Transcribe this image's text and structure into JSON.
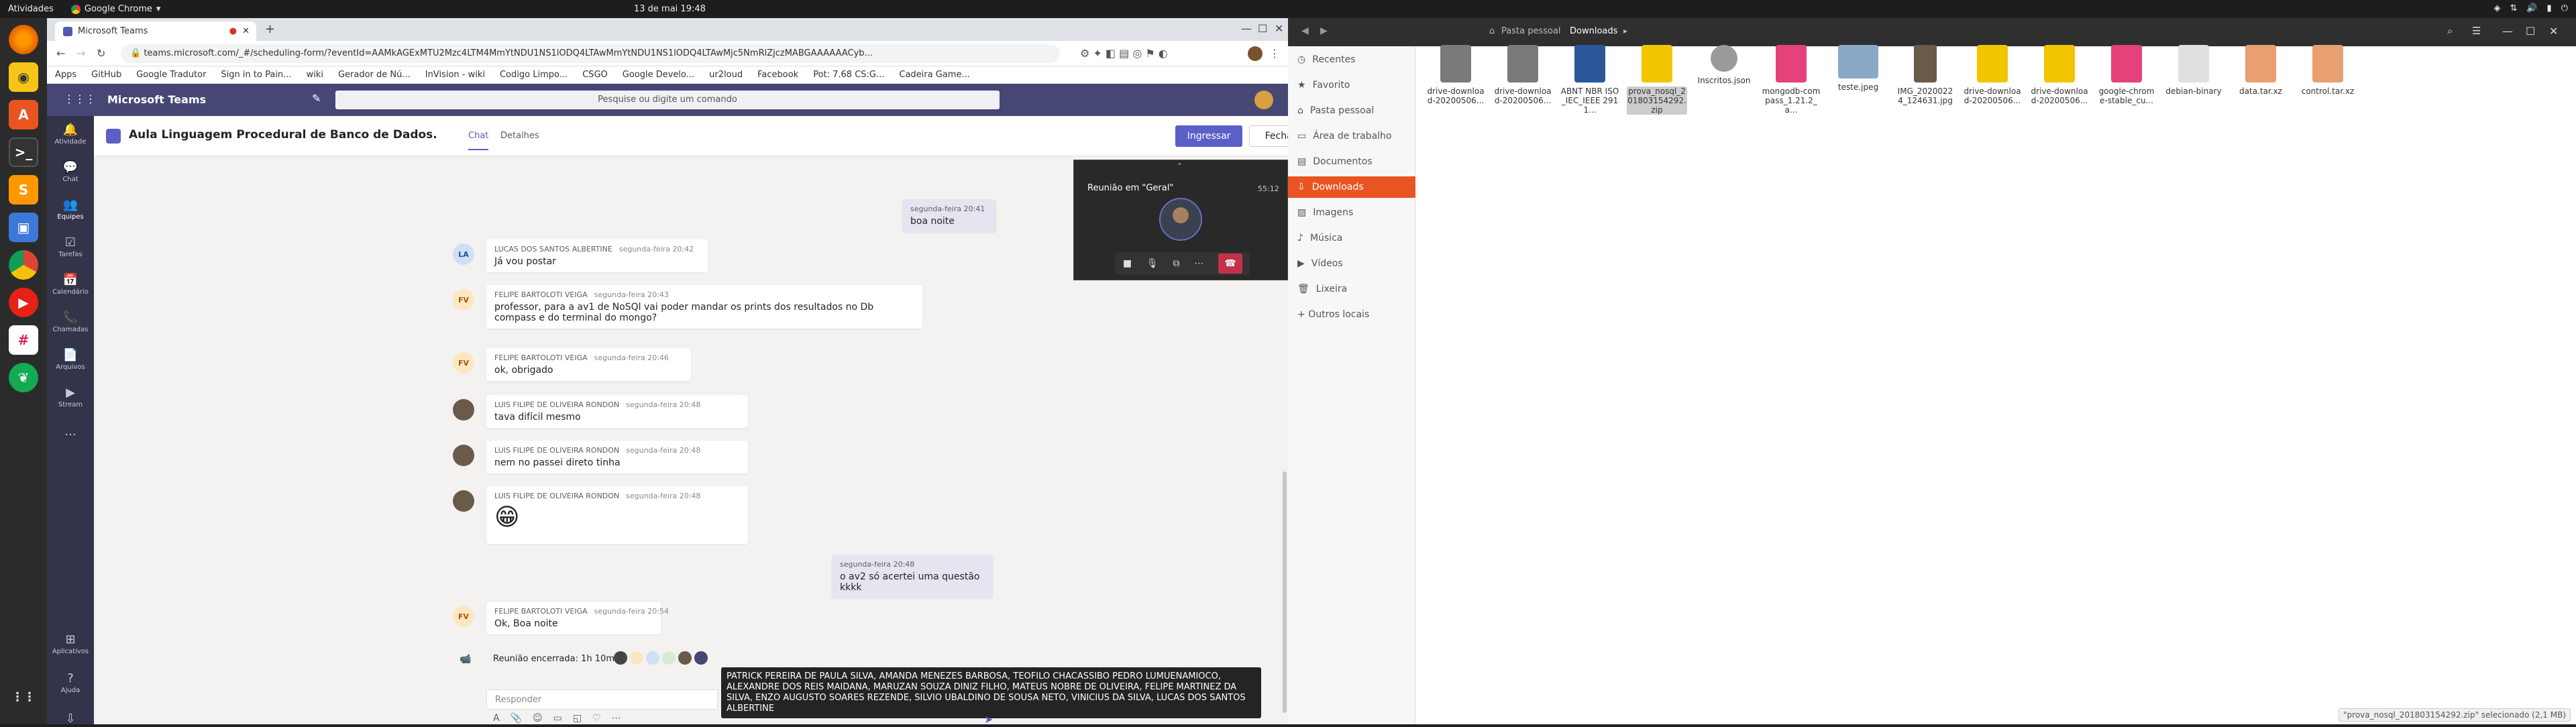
{
  "system_topbar": {
    "activities": "Atividades",
    "app_name": "Google Chrome",
    "clock": "13 de mai  19:48"
  },
  "chrome": {
    "tab_title": "Microsoft Teams",
    "url": "teams.microsoft.com/_#/scheduling-form/?eventId=AAMkAGExMTU2Mzc4LTM4MmYtNDU1NS1lODQ4LTAwMmYtNDU1NS1lODQ4LTAwMjc5NmRlZjczMABGAAAAAACyb...",
    "bookmarks": [
      "Apps",
      "GitHub",
      "Google Tradutor",
      "Sign in to Pain...",
      "wiki",
      "Gerador de Nú...",
      "InVision - wiki",
      "Codigo Limpo...",
      "CSGO",
      "Google Develo...",
      "ur2loud",
      "Facebook",
      "Pot: 7.68 CS:G...",
      "Cadeira Game..."
    ]
  },
  "teams": {
    "app_title": "Microsoft Teams",
    "search_placeholder": "Pesquise ou digite um comando",
    "rail": [
      {
        "label": "Atividade",
        "icon": "bell-icon"
      },
      {
        "label": "Chat",
        "icon": "chat-icon"
      },
      {
        "label": "Equipes",
        "icon": "teams-icon"
      },
      {
        "label": "Tarefas",
        "icon": "tasks-icon"
      },
      {
        "label": "Calendário",
        "icon": "calendar-icon"
      },
      {
        "label": "Chamadas",
        "icon": "phone-icon"
      },
      {
        "label": "Arquivos",
        "icon": "files-icon"
      },
      {
        "label": "Stream",
        "icon": "stream-icon"
      },
      {
        "label": "...",
        "icon": "more-icon"
      },
      {
        "label": "Aplicativos",
        "icon": "apps-icon"
      },
      {
        "label": "Ajuda",
        "icon": "help-icon"
      }
    ],
    "channel": {
      "name": "Aula Linguagem Procedural de Banco de Dados.",
      "tab_chat": "Chat",
      "tab_details": "Detalhes",
      "join_button": "Ingressar",
      "close_button": "Fechar"
    },
    "messages": [
      {
        "author": "",
        "time": "segunda-feira 20:41",
        "text": "boa noite",
        "mine": true
      },
      {
        "author": "LUCAS DOS SANTOS ALBERTINE",
        "time": "segunda-feira 20:42",
        "text": "Já vou postar",
        "initials": "LA"
      },
      {
        "author": "FELIPE BARTOLOTI VEIGA",
        "time": "segunda-feira 20:43",
        "text": "professor, para a av1 de NoSQl vai poder mandar os prints dos resultados no Db compass e  do terminal do mongo?",
        "initials": "FV"
      },
      {
        "author": "FELIPE BARTOLOTI VEIGA",
        "time": "segunda-feira 20:46",
        "text": "ok, obrigado",
        "initials": "FV"
      },
      {
        "author": "LUIS FILIPE DE OLIVEIRA RONDON",
        "time": "segunda-feira 20:48",
        "text": "tava difícil mesmo"
      },
      {
        "author": "LUIS FILIPE DE OLIVEIRA RONDON",
        "time": "segunda-feira 20:48",
        "text": "nem no passei direto tinha"
      },
      {
        "author": "LUIS FILIPE DE OLIVEIRA RONDON",
        "time": "segunda-feira 20:48",
        "text": "😁"
      },
      {
        "author": "",
        "time": "segunda-feira 20:48",
        "text": "o av2 só acertei uma questão kkkk",
        "mine": true
      },
      {
        "author": "FELIPE BARTOLOTI VEIGA",
        "time": "segunda-feira 20:54",
        "text": "Ok, Boa noite",
        "initials": "FV"
      }
    ],
    "meeting_ended": "Reunião encerrada: 1h 10m",
    "participants_tooltip": "PATRICK PEREIRA DE PAULA SILVA, AMANDA MENEZES BARBOSA, TEOFILO CHACASSIBO PEDRO LUMUENAMIOCO, ALEXANDRE DOS REIS MAIDANA, MARUZAN SOUZA DINIZ FILHO, MATEUS NOBRE DE OLIVEIRA, FELIPE MARTINEZ DA SILVA, ENZO AUGUSTO SOARES REZENDE, SILVIO UBALDINO DE SOUSA NETO, VINICIUS DA SILVA, LUCAS DOS SANTOS ALBERTINE",
    "reply_placeholder": "Responder",
    "call": {
      "title": "Reunião em \"Geral\"",
      "duration": "55:12"
    }
  },
  "files": {
    "location_home": "Pasta pessoal",
    "location_current": "Downloads",
    "sidebar": [
      {
        "label": "Recentes",
        "icon": "clock-icon"
      },
      {
        "label": "Favorito",
        "icon": "star-icon"
      },
      {
        "label": "Pasta pessoal",
        "icon": "home-icon"
      },
      {
        "label": "Área de trabalho",
        "icon": "desktop-icon"
      },
      {
        "label": "Documentos",
        "icon": "document-icon"
      },
      {
        "label": "Downloads",
        "icon": "download-icon",
        "active": true
      },
      {
        "label": "Imagens",
        "icon": "image-icon"
      },
      {
        "label": "Música",
        "icon": "music-icon"
      },
      {
        "label": "Vídeos",
        "icon": "video-icon"
      },
      {
        "label": "Lixeira",
        "icon": "trash-icon"
      },
      {
        "label": "+ Outros locais",
        "icon": "plus-icon"
      }
    ],
    "items": [
      {
        "name": "drive-download-20200506...",
        "kind": "folder",
        "color": "#7a7a7a"
      },
      {
        "name": "drive-download-20200506...",
        "kind": "folder",
        "color": "#7a7a7a"
      },
      {
        "name": "ABNT NBR ISO_IEC_IEEE 2911...",
        "kind": "word",
        "color": "#2b579a"
      },
      {
        "name": "prova_nosql_201803154292.zip",
        "kind": "zip",
        "color": "#f2c500",
        "selected": true
      },
      {
        "name": "Inscritos.json",
        "kind": "json",
        "color": "#9a9a9a"
      },
      {
        "name": "mongodb-compass_1.21.2_a...",
        "kind": "deb",
        "color": "#e5417a"
      },
      {
        "name": "teste.jpeg",
        "kind": "image",
        "color": "#8aa8c8"
      },
      {
        "name": "IMG_20200224_124631.jpg",
        "kind": "image",
        "color": "#6a5a48"
      },
      {
        "name": "drive-download-20200506...",
        "kind": "zip",
        "color": "#f2c500"
      },
      {
        "name": "drive-download-20200506...",
        "kind": "zip",
        "color": "#f2c500"
      },
      {
        "name": "google-chrome-stable_cu...",
        "kind": "deb",
        "color": "#e5417a"
      },
      {
        "name": "debian-binary",
        "kind": "text",
        "color": "#e0e0e0"
      },
      {
        "name": "data.tar.xz",
        "kind": "archive",
        "color": "#e8a070"
      },
      {
        "name": "control.tar.xz",
        "kind": "archive",
        "color": "#e8a070"
      }
    ],
    "status": "\"prova_nosql_201803154292.zip\" selecionado (2,1 MB)"
  },
  "colors": {
    "teams_purple": "#464775",
    "ubuntu_orange": "#e95420",
    "end_call_red": "#c4314b"
  }
}
